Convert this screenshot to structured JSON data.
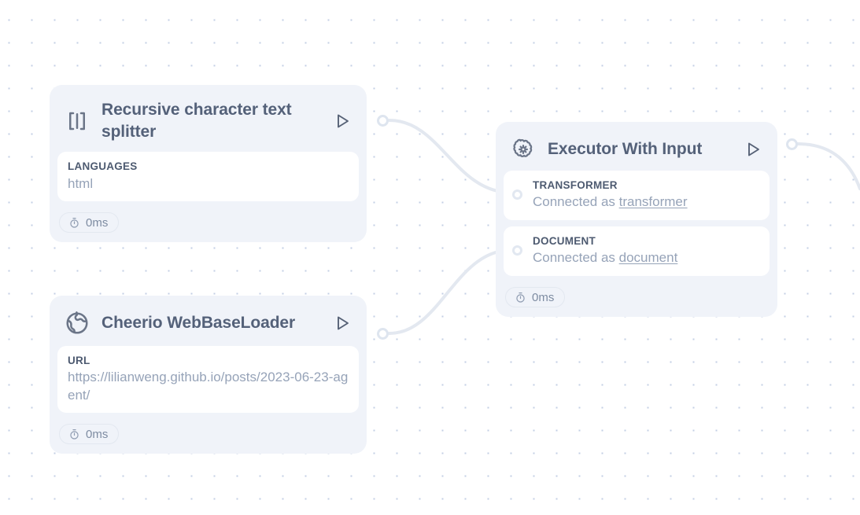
{
  "canvas": {
    "background_color": "#ffffff",
    "grid_dot_color": "#c3cfe4",
    "edge_color": "#e3e8f0"
  },
  "nodes": [
    {
      "id": "recursive-character-text-splitter",
      "icon": "text-split-icon",
      "title": "Recursive character text splitter",
      "run_label": "play-icon",
      "fields": [
        {
          "label": "LANGUAGES",
          "value": "html"
        }
      ],
      "timer": {
        "icon": "stopwatch-icon",
        "value": "0ms"
      }
    },
    {
      "id": "cheerio-webbaseloader",
      "icon": "globe-icon",
      "title": "Cheerio WebBaseLoader",
      "run_label": "play-icon",
      "fields": [
        {
          "label": "URL",
          "value": "https://lilianweng.github.io/posts/2023-06-23-agent/"
        }
      ],
      "timer": {
        "icon": "stopwatch-icon",
        "value": "0ms"
      }
    },
    {
      "id": "executor-with-input",
      "icon": "brain-cog-icon",
      "title": "Executor With Input",
      "run_label": "play-icon",
      "fields": [
        {
          "label": "TRANSFORMER",
          "connected_prefix": "Connected as ",
          "connected_target": "transformer"
        },
        {
          "label": "DOCUMENT",
          "connected_prefix": "Connected as ",
          "connected_target": "document"
        }
      ],
      "timer": {
        "icon": "stopwatch-icon",
        "value": "0ms"
      }
    }
  ]
}
